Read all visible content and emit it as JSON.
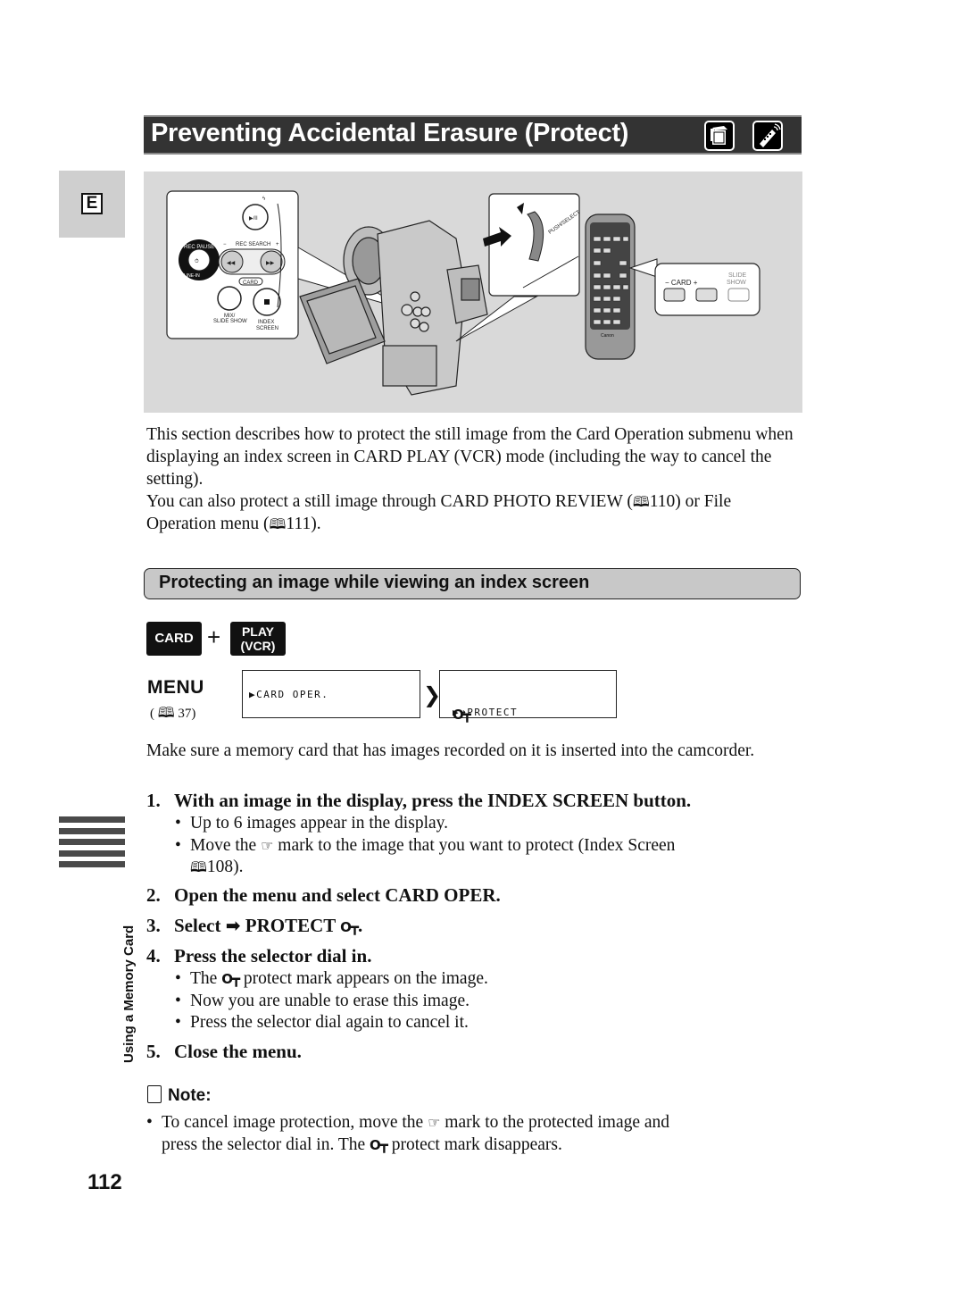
{
  "header": {
    "title": "Preventing Accidental Erasure (Protect)",
    "icons": [
      "camcorder-card-icon",
      "remote-control-icon"
    ]
  },
  "language_tab": "E",
  "illustration": {
    "camcorder_panel": {
      "labels": [
        "REC PAUSE",
        "LINE-IN",
        "REC SEARCH",
        "CARD",
        "MIX/",
        "SLIDE SHOW",
        "INDEX",
        "SCREEN"
      ],
      "minus": "−",
      "plus": "+"
    },
    "dial_panel": {
      "label": "PUSH/SELECT"
    },
    "remote_panel": {
      "card_label": "− CARD +",
      "slide_label_1": "SLIDE",
      "slide_label_2": "SHOW",
      "brand": "Canon"
    }
  },
  "intro": {
    "line1": "This section describes how to protect the still image from the Card Operation submenu when displaying an index screen in CARD PLAY (VCR) mode (including the way to cancel the setting).",
    "line2_pre": "You can also protect a still image through CARD PHOTO REVIEW (",
    "line2_ref": "110",
    "line2_mid": ") or File Operation menu (",
    "line2_ref2": "111",
    "line2_post": ")."
  },
  "section": {
    "title": "Protecting an image while viewing an index screen"
  },
  "mode": {
    "card": "CARD",
    "plus": "+",
    "play_line1": "PLAY",
    "play_line2": "(VCR)"
  },
  "menu": {
    "label": "MENU",
    "ref_open": "(",
    "ref_page": "37)",
    "box1": "▶CARD OPER.",
    "box2": "▶➜PROTECT"
  },
  "prereq": "Make sure a memory card that has images recorded on it is inserted into the camcorder.",
  "steps": [
    {
      "num": "1.",
      "text": "With an image in the display, press the INDEX SCREEN button.",
      "bullets": [
        "Up to 6 images appear in the display.",
        {
          "pre": "Move the",
          "post": "mark to the image that you want to protect (Index Screen"
        },
        "108)."
      ]
    },
    {
      "num": "2.",
      "text": "Open the menu and select CARD OPER."
    },
    {
      "num": "3.",
      "pre": "Select",
      "text": "PROTECT",
      "post": "."
    },
    {
      "num": "4.",
      "text": "Press the selector dial in.",
      "bullets": [
        {
          "pre": "The",
          "post": "protect mark appears on the image."
        },
        "Now you are unable to erase this image.",
        "Press the selector dial again to cancel it."
      ]
    },
    {
      "num": "5.",
      "text": "Close the menu."
    }
  ],
  "note": {
    "heading": "Note:",
    "line1_pre": "To cancel image protection, move the",
    "line1_post": "mark to the protected image and",
    "line2_pre": "press the selector dial in. The",
    "line2_post": "protect mark disappears."
  },
  "sidebar": {
    "section_label": "Using a Memory Card"
  },
  "page_number": "112"
}
